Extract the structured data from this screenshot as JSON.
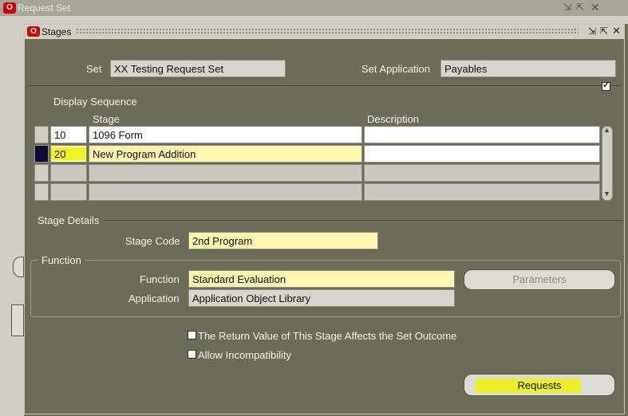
{
  "back_window": {
    "title": "Request Set"
  },
  "window": {
    "title": "Stages"
  },
  "header": {
    "set_label": "Set",
    "set_value": "XX Testing Request Set",
    "app_label": "Set Application",
    "app_value": "Payables"
  },
  "table": {
    "display_sequence_label": "Display Sequence",
    "col_stage": "Stage",
    "col_description": "Description",
    "rows": [
      {
        "seq": "10",
        "stage": "1096 Form",
        "description": ""
      },
      {
        "seq": "20",
        "stage": "New Program Addition",
        "description": ""
      }
    ]
  },
  "stage_details": {
    "section_label": "Stage Details",
    "stage_code_label": "Stage Code",
    "stage_code_value": "2nd Program"
  },
  "function": {
    "section_label": "Function",
    "function_label": "Function",
    "function_value": "Standard Evaluation",
    "application_label": "Application",
    "application_value": "Application Object Library",
    "parameters_button": "Parameters"
  },
  "options": {
    "return_value_label": "The Return Value of This Stage Affects the Set Outcome",
    "allow_incompat_label": "Allow Incompatibility"
  },
  "requests_button": "Requests",
  "colors": {
    "highlight": "#f0f500",
    "oracle_red": "#d40000",
    "field_yellow": "#fff4b0"
  }
}
